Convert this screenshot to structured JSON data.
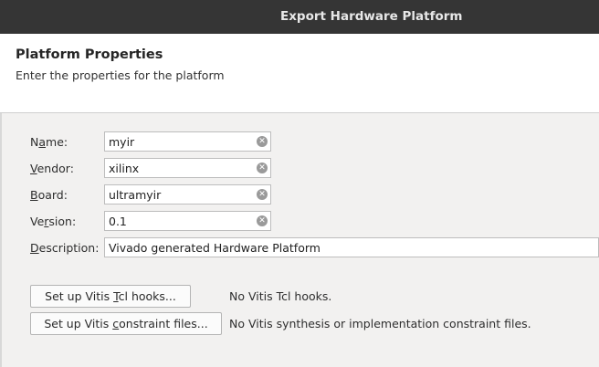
{
  "window": {
    "title": "Export Hardware Platform"
  },
  "header": {
    "heading": "Platform Properties",
    "subtitle": "Enter the properties for the platform"
  },
  "form": {
    "name": {
      "label_pre": "N",
      "label_mnemonic": "a",
      "label_post": "me:",
      "value": "myir"
    },
    "vendor": {
      "label_pre": "",
      "label_mnemonic": "V",
      "label_post": "endor:",
      "value": "xilinx"
    },
    "board": {
      "label_pre": "",
      "label_mnemonic": "B",
      "label_post": "oard:",
      "value": "ultramyir"
    },
    "version": {
      "label_pre": "Ve",
      "label_mnemonic": "r",
      "label_post": "sion:",
      "value": "0.1"
    },
    "description": {
      "label_pre": "",
      "label_mnemonic": "D",
      "label_post": "escription:",
      "value": "Vivado generated Hardware Platform"
    }
  },
  "hooks": {
    "tcl_button": {
      "pre": "Set up Vitis ",
      "mnemonic": "T",
      "post": "cl hooks..."
    },
    "tcl_status": "No Vitis Tcl hooks.",
    "constraint_button": {
      "pre": "Set up Vitis ",
      "mnemonic": "c",
      "post": "onstraint files..."
    },
    "constraint_status": "No Vitis synthesis or implementation constraint files."
  },
  "icons": {
    "clear": "clear-icon"
  }
}
